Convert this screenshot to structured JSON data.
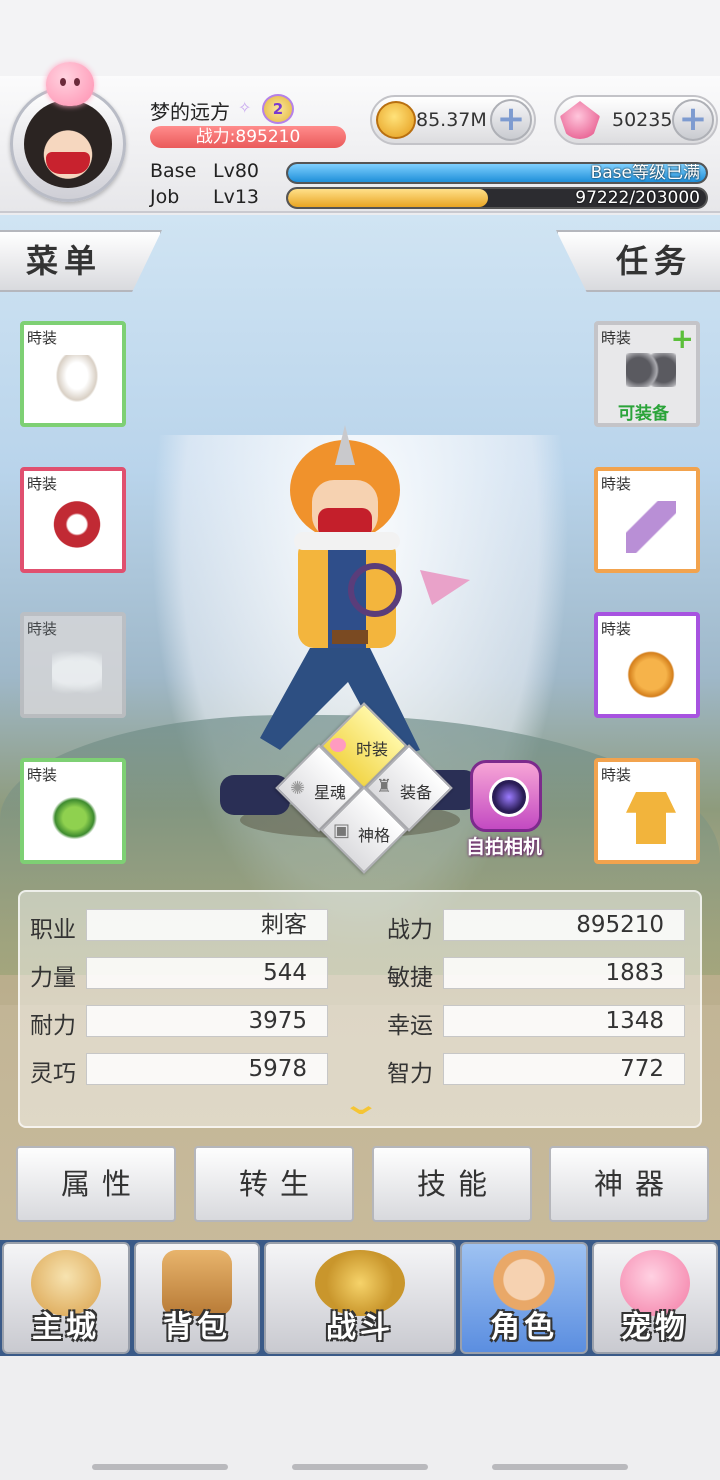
{
  "player": {
    "name": "梦的远方",
    "vip_level": "2",
    "power_text": "战力:895210"
  },
  "currency": {
    "gold": "85.37M",
    "gems": "50235"
  },
  "levels": {
    "base_label": "Base",
    "base_level": "Lv80",
    "base_status": "Base等级已满",
    "base_progress": 1.0,
    "job_label": "Job",
    "job_level": "Lv13",
    "job_exp": "97222/203000",
    "job_progress": 0.479
  },
  "tabs": {
    "menu": "菜单",
    "task": "任务"
  },
  "slots": {
    "label": "時装",
    "can_equip": "可装备",
    "plus_icon": "+"
  },
  "radial": {
    "costume": "时装",
    "star_soul": "星魂",
    "equipment": "装备",
    "divinity": "神格"
  },
  "selfie": "自拍相机",
  "stats": {
    "job_label": "职业",
    "job_value": "刺客",
    "power_label": "战力",
    "power_value": "895210",
    "str_label": "力量",
    "str_value": "544",
    "agi_label": "敏捷",
    "agi_value": "1883",
    "vit_label": "耐力",
    "vit_value": "3975",
    "luk_label": "幸运",
    "luk_value": "1348",
    "dex_label": "灵巧",
    "dex_value": "5978",
    "int_label": "智力",
    "int_value": "772"
  },
  "actions": {
    "attributes": "属性",
    "rebirth": "转生",
    "skills": "技能",
    "artifact": "神器"
  },
  "nav": {
    "city": "主城",
    "bag": "背包",
    "battle": "战斗",
    "character": "角色",
    "pet": "宠物"
  },
  "colors": {
    "power_bar": "#ea5a5a",
    "base_exp": "#3aa7e8",
    "job_exp": "#f3be3e",
    "active_nav": "#5b8ee0",
    "slot_green": "#7ed074",
    "slot_red": "#e0506f",
    "slot_orange": "#f2a34e",
    "slot_purple": "#a753e0"
  },
  "icons": [
    "pet-avatar-icon",
    "gold-coin-icon",
    "gem-icon",
    "plus-icon",
    "chevron-down-icon",
    "selfie-camera-icon"
  ]
}
